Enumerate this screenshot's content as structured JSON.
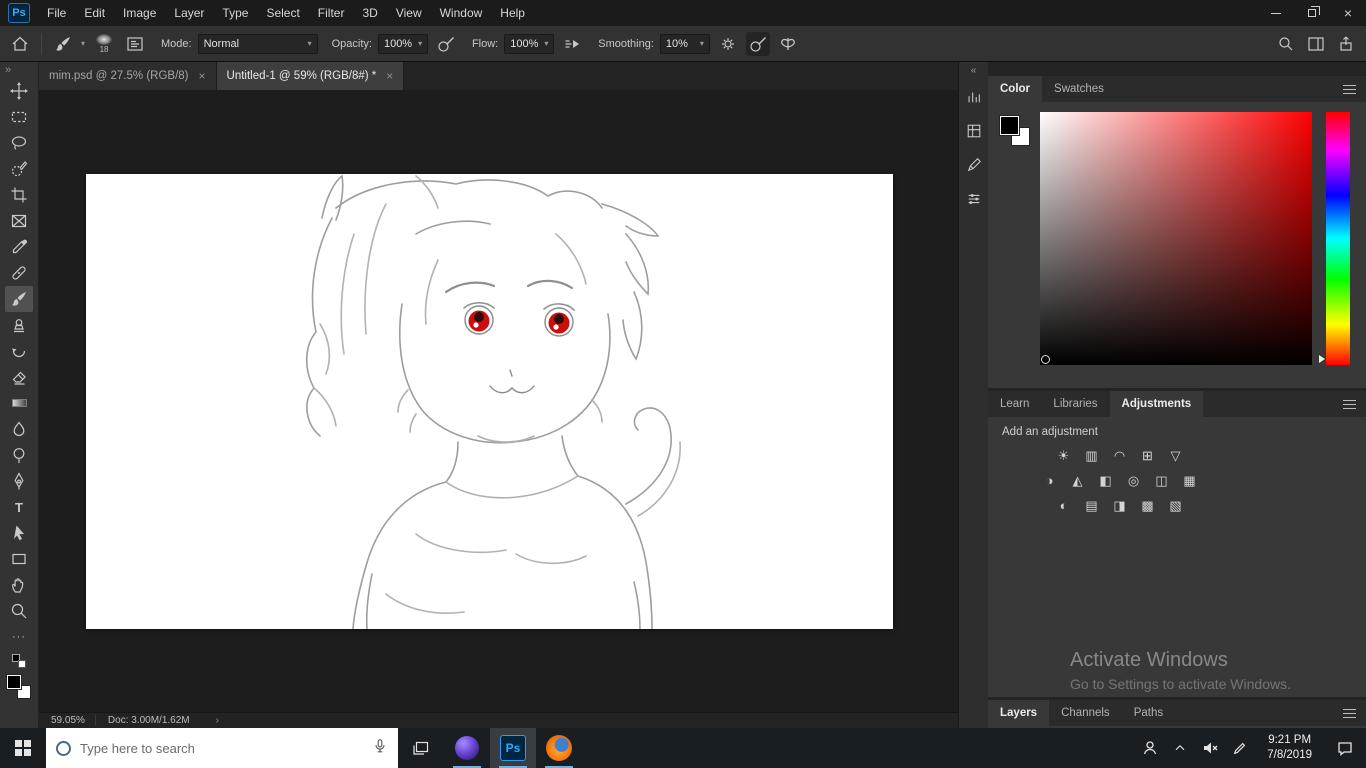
{
  "window": {
    "logo_text": "Ps"
  },
  "menubar": {
    "items": [
      "File",
      "Edit",
      "Image",
      "Layer",
      "Type",
      "Select",
      "Filter",
      "3D",
      "View",
      "Window",
      "Help"
    ]
  },
  "options": {
    "brush_size": "18",
    "mode_label": "Mode:",
    "mode_value": "Normal",
    "opacity_label": "Opacity:",
    "opacity_value": "100%",
    "flow_label": "Flow:",
    "flow_value": "100%",
    "smoothing_label": "Smoothing:",
    "smoothing_value": "10%"
  },
  "tabs": [
    {
      "label": "mim.psd @ 27.5% (RGB/8)",
      "close": "×"
    },
    {
      "label": "Untitled-1 @ 59% (RGB/8#) *",
      "close": "×"
    }
  ],
  "statusbar": {
    "zoom": "59.05%",
    "doc": "Doc: 3.00M/1.62M",
    "chevron": "›"
  },
  "panels": {
    "color": {
      "tab_color": "Color",
      "tab_swatches": "Swatches"
    },
    "adjust": {
      "tab_learn": "Learn",
      "tab_libraries": "Libraries",
      "tab_adjustments": "Adjustments",
      "add_label": "Add an adjustment"
    },
    "bottom": {
      "tab_layers": "Layers",
      "tab_channels": "Channels",
      "tab_paths": "Paths"
    }
  },
  "watermark": {
    "line1": "Activate Windows",
    "line2": "Go to Settings to activate Windows."
  },
  "taskbar": {
    "search_placeholder": "Type here to search",
    "clock_time": "9:21 PM",
    "clock_date": "7/8/2019"
  },
  "icons": {
    "toolbar_collapse": "»",
    "panel_expand": "«",
    "type_tool": "T",
    "more_tools": "···",
    "dropdown_caret": "▾",
    "adjustments": {
      "brightness_contrast": "☀",
      "levels": "▥",
      "curves": "◠",
      "exposure": "⊞",
      "vibrance": "▽",
      "hue_saturation": "◑",
      "color_balance": "◭",
      "black_white": "◧",
      "photo_filter": "◎",
      "channel_mixer": "◫",
      "color_lookup": "▦",
      "invert": "◐",
      "posterize": "▤",
      "threshold": "◨",
      "selective_color": "▩",
      "gradient_map": "▧"
    }
  },
  "colors": {
    "accent_blue": "#31a8ff",
    "eye_red": "#cf0d0d",
    "canvas_white": "#ffffff"
  }
}
